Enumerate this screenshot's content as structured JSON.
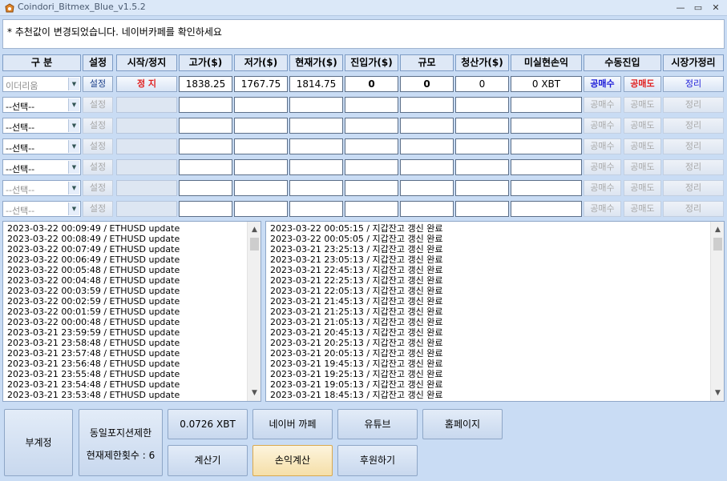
{
  "window": {
    "title": "Coindori_Bitmex_Blue_v1.5.2",
    "minimize": "—",
    "maximize": "▭",
    "close": "✕"
  },
  "notice": "* 추천값이 변경되었습니다. 네이버카페를 확인하세요",
  "headers": [
    "구 분",
    "설정",
    "시작/정지",
    "고가($)",
    "저가($)",
    "현재가($)",
    "진입가($)",
    "규모",
    "청산가($)",
    "미실현손익",
    "수동진입",
    "시장가정리"
  ],
  "row1": {
    "select": "이더리움",
    "set": "설정",
    "startstop": "정 지",
    "high": "1838.25",
    "low": "1767.75",
    "current": "1814.75",
    "entry": "0",
    "size": "0",
    "liq": "0",
    "pnl": "0 XBT",
    "long": "공매수",
    "short": "공매도",
    "close": "정리"
  },
  "empty_row": {
    "select": "--선택--",
    "set": "설정",
    "long": "공매수",
    "short": "공매도",
    "close": "정리"
  },
  "log_left": [
    "2023-03-22 00:09:49 / ETHUSD update",
    "2023-03-22 00:08:49 / ETHUSD update",
    "2023-03-22 00:07:49 / ETHUSD update",
    "2023-03-22 00:06:49 / ETHUSD update",
    "2023-03-22 00:05:48 / ETHUSD update",
    "2023-03-22 00:04:48 / ETHUSD update",
    "2023-03-22 00:03:59 / ETHUSD update",
    "2023-03-22 00:02:59 / ETHUSD update",
    "2023-03-22 00:01:59 / ETHUSD update",
    "2023-03-22 00:00:48 / ETHUSD update",
    "2023-03-21 23:59:59 / ETHUSD update",
    "2023-03-21 23:58:48 / ETHUSD update",
    "2023-03-21 23:57:48 / ETHUSD update",
    "2023-03-21 23:56:48 / ETHUSD update",
    "2023-03-21 23:55:48 / ETHUSD update",
    "2023-03-21 23:54:48 / ETHUSD update",
    "2023-03-21 23:53:48 / ETHUSD update"
  ],
  "log_right": [
    "2023-03-22 00:05:15 / 지갑잔고 갱신 완료",
    "2023-03-22 00:05:05 / 지갑잔고 갱신 완료",
    "2023-03-21 23:25:13 / 지갑잔고 갱신 완료",
    "2023-03-21 23:05:13 / 지갑잔고 갱신 완료",
    "2023-03-21 22:45:13 / 지갑잔고 갱신 완료",
    "2023-03-21 22:25:13 / 지갑잔고 갱신 완료",
    "2023-03-21 22:05:13 / 지갑잔고 갱신 완료",
    "2023-03-21 21:45:13 / 지갑잔고 갱신 완료",
    "2023-03-21 21:25:13 / 지갑잔고 갱신 완료",
    "2023-03-21 21:05:13 / 지갑잔고 갱신 완료",
    "2023-03-21 20:45:13 / 지갑잔고 갱신 완료",
    "2023-03-21 20:25:13 / 지갑잔고 갱신 완료",
    "2023-03-21 20:05:13 / 지갑잔고 갱신 완료",
    "2023-03-21 19:45:13 / 지갑잔고 갱신 완료",
    "2023-03-21 19:25:13 / 지갑잔고 갱신 완료",
    "2023-03-21 19:05:13 / 지갑잔고 갱신 완료",
    "2023-03-21 18:45:13 / 지갑잔고 갱신 완료"
  ],
  "bottom": {
    "sub_account": "부계정",
    "position_limit": "동일포지션제한",
    "limit_count": "현재제한횟수 : 6",
    "balance": "0.0726 XBT",
    "naver": "네이버 까페",
    "youtube": "유튜브",
    "homepage": "홈페이지",
    "calculator": "계산기",
    "pnl_calc": "손익계산",
    "donate": "후원하기"
  },
  "scroll_up": "▲",
  "scroll_down": "▼",
  "combo_arrow": "▼",
  "colors": {
    "stop_red": "#e02020",
    "long_blue": "#1a1ad8",
    "bg": "#c9dcf4"
  }
}
